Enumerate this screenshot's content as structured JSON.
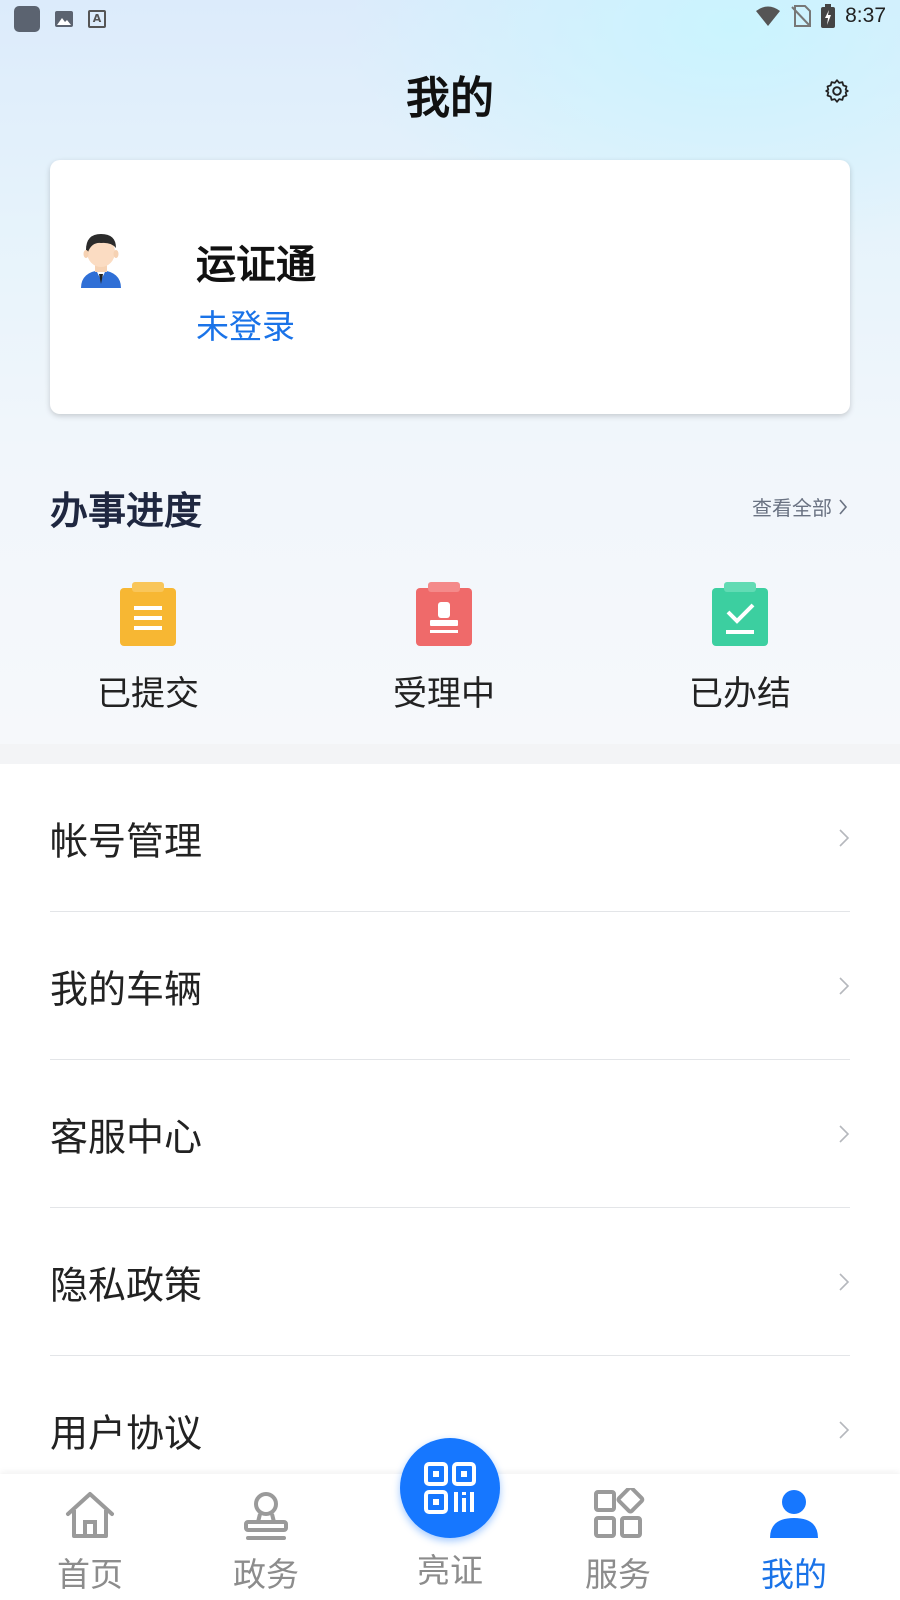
{
  "status_bar": {
    "time": "8:37"
  },
  "header": {
    "title": "我的",
    "settings_icon": "gear-icon"
  },
  "profile": {
    "app_name": "运证通",
    "login_status": "未登录",
    "avatar_icon": "user-avatar-icon"
  },
  "progress": {
    "title": "办事进度",
    "view_all": "查看全部",
    "items": [
      {
        "label": "已提交",
        "icon": "clipboard-list-icon",
        "color": "#f7b733"
      },
      {
        "label": "受理中",
        "icon": "clipboard-stamp-icon",
        "color": "#ef6a6a"
      },
      {
        "label": "已办结",
        "icon": "clipboard-check-icon",
        "color": "#3ccfa0"
      }
    ]
  },
  "menu": [
    {
      "label": "帐号管理"
    },
    {
      "label": "我的车辆"
    },
    {
      "label": "客服中心"
    },
    {
      "label": "隐私政策"
    },
    {
      "label": "用户协议"
    }
  ],
  "bottom_nav": {
    "items": [
      {
        "label": "首页",
        "icon": "home-icon"
      },
      {
        "label": "政务",
        "icon": "stamp-icon"
      },
      {
        "label": "亮证",
        "icon": "qr-code-icon"
      },
      {
        "label": "服务",
        "icon": "grid-icon"
      },
      {
        "label": "我的",
        "icon": "person-icon",
        "active": true
      }
    ],
    "active_color": "#1a73e8"
  }
}
